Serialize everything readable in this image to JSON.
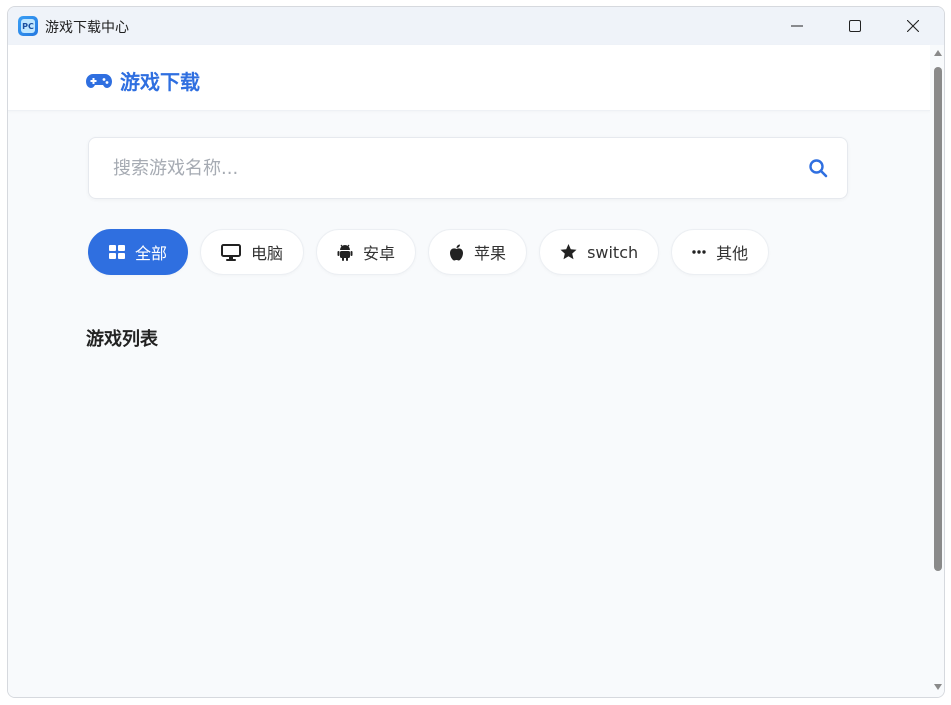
{
  "window": {
    "title": "游戏下载中心",
    "app_icon_text": "PC"
  },
  "header": {
    "brand_icon": "gamepad-icon",
    "brand_text": "游戏下载"
  },
  "search": {
    "placeholder": "搜索游戏名称...",
    "value": "",
    "icon": "search-icon"
  },
  "filters": [
    {
      "label": "全部",
      "icon": "grid-icon",
      "active": true
    },
    {
      "label": "电脑",
      "icon": "monitor-icon",
      "active": false
    },
    {
      "label": "安卓",
      "icon": "android-icon",
      "active": false
    },
    {
      "label": "苹果",
      "icon": "apple-icon",
      "active": false
    },
    {
      "label": "switch",
      "icon": "star-icon",
      "active": false
    },
    {
      "label": "其他",
      "icon": "more-icon",
      "active": false
    }
  ],
  "game_list": {
    "title": "游戏列表"
  },
  "colors": {
    "accent": "#2f6fe0",
    "background": "#f8fafc"
  }
}
